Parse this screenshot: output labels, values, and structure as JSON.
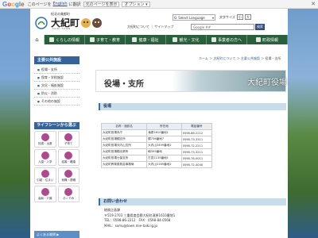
{
  "google_bar": {
    "logo": [
      "G",
      "o",
      "o",
      "g",
      "l",
      "e"
    ],
    "view_in": "このページを",
    "lang": "English",
    "translate_to": "に翻訳",
    "show_original": "元のページを表示",
    "options": "オプション ▾",
    "close": "✕"
  },
  "header": {
    "logo_sub": "紀北の美都町",
    "logo_name": "大紀町",
    "logo_en": "TAIKI TOWN",
    "select_language": "Select Language",
    "font_size_label": "文字サイズ",
    "font_small": "小",
    "font_large": "大",
    "top_links": "大紀町について ｜ サイトマップ",
    "search_placeholder": "Google ##",
    "search_button": "検索"
  },
  "nav": [
    {
      "label": "",
      "icon": "home-icon"
    },
    {
      "label": "くらしの情報",
      "icon": "house-icon"
    },
    {
      "label": "子育て・教育",
      "icon": "child-icon"
    },
    {
      "label": "健康・福祉",
      "icon": "heart-icon"
    },
    {
      "label": "観光・文化",
      "icon": "camera-icon"
    },
    {
      "label": "事業者の方へ",
      "icon": "building-icon"
    },
    {
      "label": "町政情報",
      "icon": "flag-icon"
    }
  ],
  "breadcrumb": {
    "home": "ホーム",
    "sep": " ＞ ",
    "l1": "大紀町について",
    "l2": "主要公共施設",
    "current": "役場・支所"
  },
  "sidebar": {
    "heading": "主要公共施設",
    "items": [
      "役場・支所",
      "保育・学校施設",
      "文化・福祉施設",
      "防災・消防",
      "その他の施設"
    ],
    "life_heading": "ライフシーンから選ぶ",
    "life_items": [
      "妊娠・出産",
      "子育て",
      "入園・入学",
      "結婚・離婚",
      "引越・住まい",
      "就職・退職",
      "高齢・介護",
      "おくやみ"
    ],
    "bottom": "よくある質問 ▶"
  },
  "main": {
    "title": "役場・支所",
    "title_sign": "大紀町役場",
    "section_offices": "役場",
    "section_contact": "お問い合わせ",
    "table_headers": [
      "名称・施設名",
      "所在地",
      "電話番号"
    ],
    "table_rows": [
      [
        "大紀町役場本庁",
        "滝原1610番地1",
        "0598-86-2212"
      ],
      [
        "大紀町役場錦支所",
        "錦736番地7",
        "0598-73-3311"
      ],
      [
        "大紀町役場大内山支所",
        "大内山3499番地2",
        "0598-72-2211"
      ],
      [
        "大紀町役場錦出張所",
        "崎395番地",
        "0598-73-3211"
      ],
      [
        "大紀町役場七保支所",
        "打見1135番地1",
        "0598-76-0011"
      ],
      [
        "大紀町教育委員会事務局",
        "大内山3169番地2",
        "0598-72-4040"
      ]
    ],
    "contact_lines": [
      "総務企画課",
      "〒519-2703 三重県度会郡大紀町滝原1610番地1",
      "TEL：0598-86-2212　FAX：0598-84-0568",
      "MAIL：somu@town.mie-taiki.lg.jp"
    ]
  }
}
